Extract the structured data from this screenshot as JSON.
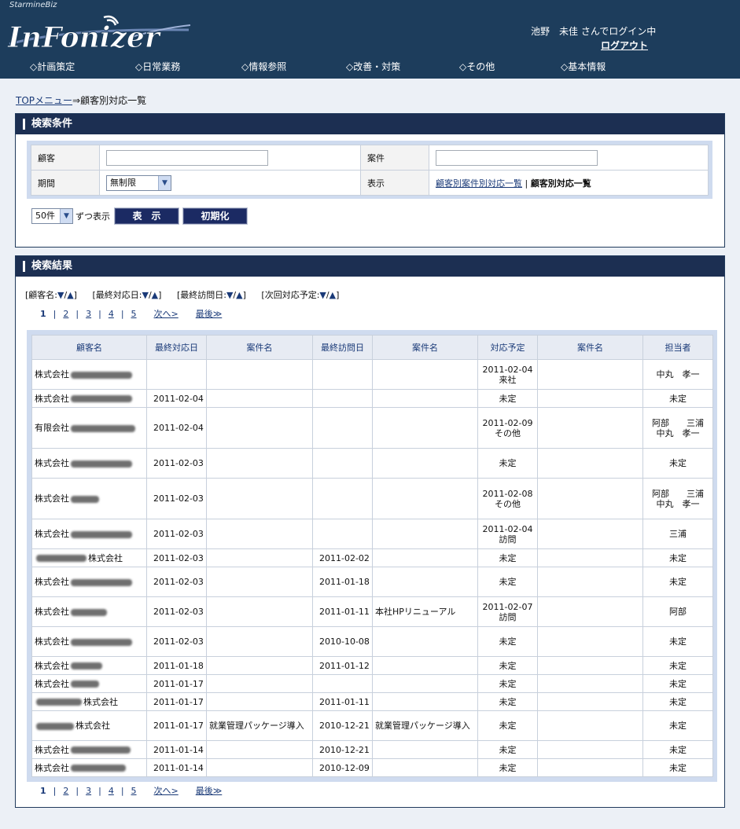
{
  "header": {
    "brand": "StarmineBiz",
    "logo": "InFonizer",
    "login_text": "池野　未佳 さんでログイン中",
    "logout": "ログアウト",
    "nav": [
      "◇計画策定",
      "◇日常業務",
      "◇情報参照",
      "◇改善・対策",
      "◇その他",
      "◇基本情報"
    ]
  },
  "breadcrumb": {
    "top": "TOPメニュー",
    "arrow": "⇒",
    "current": "顧客別対応一覧"
  },
  "search": {
    "title": "検索条件",
    "customer_label": "顧客",
    "customer_value": "",
    "case_label": "案件",
    "case_value": "",
    "period_label": "期間",
    "period_value": "無制限",
    "display_label": "表示",
    "display_link": "顧客別案件別対応一覧",
    "display_sep": "|",
    "display_current": "顧客別対応一覧",
    "perpage_value": "50件",
    "perpage_suffix": "ずつ表示",
    "show_button": "表　示",
    "reset_button": "初期化"
  },
  "results": {
    "title": "検索結果",
    "sort": [
      {
        "open": "[",
        "label": "顧客名:",
        "desc": "▼",
        "slash": "/",
        "asc": "▲",
        "close": "]"
      },
      {
        "open": "[",
        "label": "最終対応日:",
        "desc": "▼",
        "slash": "/",
        "asc": "▲",
        "close": "]"
      },
      {
        "open": "[",
        "label": "最終訪問日:",
        "desc": "▼",
        "slash": "/",
        "asc": "▲",
        "close": "]"
      },
      {
        "open": "[",
        "label": "次回対応予定:",
        "desc": "▼",
        "slash": "/",
        "asc": "▲",
        "close": "]"
      }
    ],
    "pager": {
      "current": "1",
      "pages": [
        "2",
        "3",
        "4",
        "5"
      ],
      "sep": "|",
      "next": "次へ>",
      "last": "最後≫"
    },
    "columns": [
      "顧客名",
      "最終対応日",
      "案件名",
      "最終訪問日",
      "案件名",
      "対応予定",
      "案件名",
      "担当者"
    ],
    "rows": [
      {
        "customer": "株式会社",
        "last_action": "",
        "case1": "",
        "last_visit": "",
        "case2": "",
        "plan": "2011-02-04 来社",
        "case3": "",
        "staff": "中丸　孝一"
      },
      {
        "customer": "株式会社",
        "last_action": "2011-02-04",
        "case1": "",
        "last_visit": "",
        "case2": "",
        "plan": "未定",
        "case3": "",
        "staff": "未定"
      },
      {
        "customer": "有限会社",
        "last_action": "2011-02-04",
        "case1": "",
        "last_visit": "",
        "case2": "",
        "plan": "2011-02-09 その他",
        "case3": "",
        "staff": "阿部　　三浦　 中丸　孝一"
      },
      {
        "customer": "株式会社",
        "last_action": "2011-02-03",
        "case1": "",
        "last_visit": "",
        "case2": "",
        "plan": "未定",
        "case3": "",
        "staff": "未定"
      },
      {
        "customer": "株式会社",
        "last_action": "2011-02-03",
        "case1": "",
        "last_visit": "",
        "case2": "",
        "plan": "2011-02-08 その他",
        "case3": "",
        "staff": "阿部　　三浦　 中丸　孝一"
      },
      {
        "customer": "株式会社",
        "last_action": "2011-02-03",
        "case1": "",
        "last_visit": "",
        "case2": "",
        "plan": "2011-02-04 訪問",
        "case3": "",
        "staff": "三浦"
      },
      {
        "customer": "株式会社",
        "last_action": "2011-02-03",
        "case1": "",
        "last_visit": "2011-02-02",
        "case2": "",
        "plan": "未定",
        "case3": "",
        "staff": "未定"
      },
      {
        "customer": "株式会社",
        "last_action": "2011-02-03",
        "case1": "",
        "last_visit": "2011-01-18",
        "case2": "",
        "plan": "未定",
        "case3": "",
        "staff": "未定"
      },
      {
        "customer": "株式会社",
        "last_action": "2011-02-03",
        "case1": "",
        "last_visit": "2011-01-11",
        "case2": "本社HPリニューアル",
        "plan": "2011-02-07 訪問",
        "case3": "",
        "staff": "阿部"
      },
      {
        "customer": "株式会社",
        "last_action": "2011-02-03",
        "case1": "",
        "last_visit": "2010-10-08",
        "case2": "",
        "plan": "未定",
        "case3": "",
        "staff": "未定"
      },
      {
        "customer": "株式会社",
        "last_action": "2011-01-18",
        "case1": "",
        "last_visit": "2011-01-12",
        "case2": "",
        "plan": "未定",
        "case3": "",
        "staff": "未定"
      },
      {
        "customer": "株式会社",
        "last_action": "2011-01-17",
        "case1": "",
        "last_visit": "",
        "case2": "",
        "plan": "未定",
        "case3": "",
        "staff": "未定"
      },
      {
        "customer": "株式会社",
        "last_action": "2011-01-17",
        "case1": "",
        "last_visit": "2011-01-11",
        "case2": "",
        "plan": "未定",
        "case3": "",
        "staff": "未定"
      },
      {
        "customer": "株式会社",
        "last_action": "2011-01-17",
        "case1": "就業管理パッケージ導入",
        "last_visit": "2010-12-21",
        "case2": "就業管理パッケージ導入",
        "plan": "未定",
        "case3": "",
        "staff": "未定"
      },
      {
        "customer": "株式会社",
        "last_action": "2011-01-14",
        "case1": "",
        "last_visit": "2010-12-21",
        "case2": "",
        "plan": "未定",
        "case3": "",
        "staff": "未定"
      },
      {
        "customer": "株式会社",
        "last_action": "2011-01-14",
        "case1": "",
        "last_visit": "2010-12-09",
        "case2": "",
        "plan": "未定",
        "case3": "",
        "staff": "未定"
      }
    ]
  }
}
